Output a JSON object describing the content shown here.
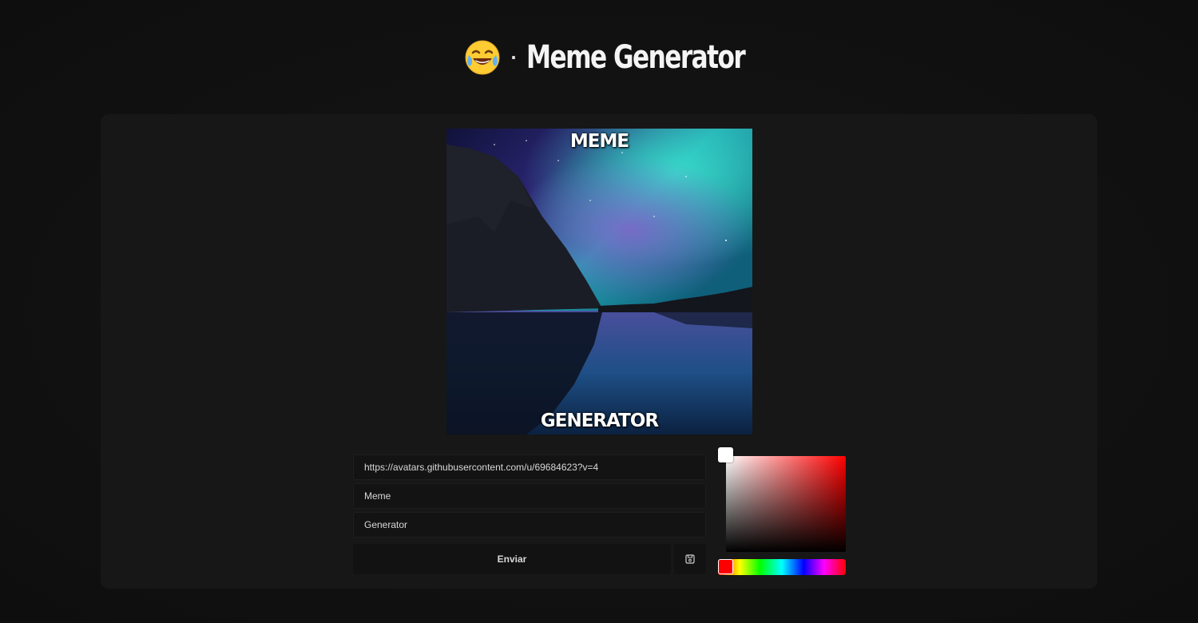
{
  "header": {
    "emoji_icon": "face-with-tears-of-joy-icon",
    "separator": "·",
    "title": "Meme Generator"
  },
  "meme": {
    "top_text": "MEME",
    "bottom_text": "GENERATOR"
  },
  "form": {
    "image_url": "https://avatars.githubusercontent.com/u/69684623?v=4",
    "top_text_value": "Meme",
    "bottom_text_value": "Generator",
    "submit_label": "Enviar",
    "save_icon": "save-icon"
  },
  "color_picker": {
    "selected_color": "#ffffff",
    "hue_color": "#ff0000"
  },
  "colors": {
    "background": "#0f0f0f",
    "card": "#171717",
    "field": "#131313"
  }
}
